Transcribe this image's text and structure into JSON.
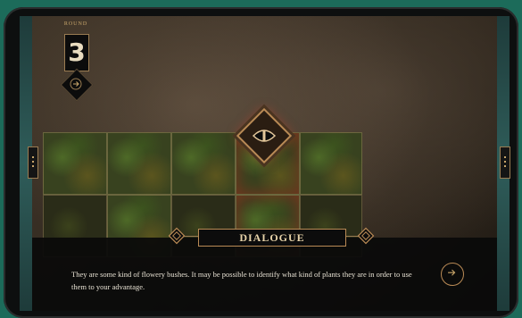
{
  "round": {
    "label": "ROUND",
    "number": "3"
  },
  "dialog": {
    "title": "DIALOGUE",
    "text": "They are some kind of flowery bushes. It may be possible to identify what kind of plants they are in order to use them to your advantage."
  },
  "icons": {
    "round_arrow": "arrow-right-icon",
    "node": "eye-icon",
    "next": "arrow-right-circle-icon"
  },
  "colors": {
    "accent": "#b98a55",
    "background": "#1c6b5a"
  }
}
